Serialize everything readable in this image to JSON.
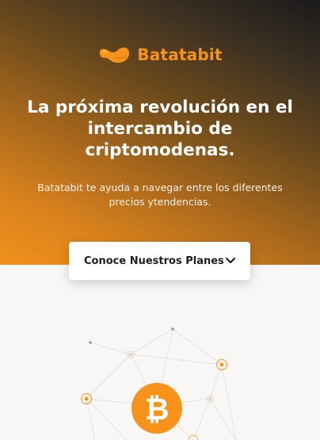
{
  "brand": {
    "name": "Batatabit",
    "accent_color": "#f7931a",
    "logo_icon": "potato-logo-icon"
  },
  "hero": {
    "title": "La próxima revolución en el intercambio de criptomodenas.",
    "subtitle": "Batatabit te ayuda a navegar entre los diferentes precios ytendencias."
  },
  "cta": {
    "label": "Conoce Nuestros Planes",
    "icon": "chevron-down-icon"
  },
  "illustration": {
    "icon": "bitcoin-icon",
    "symbol": "₿"
  }
}
